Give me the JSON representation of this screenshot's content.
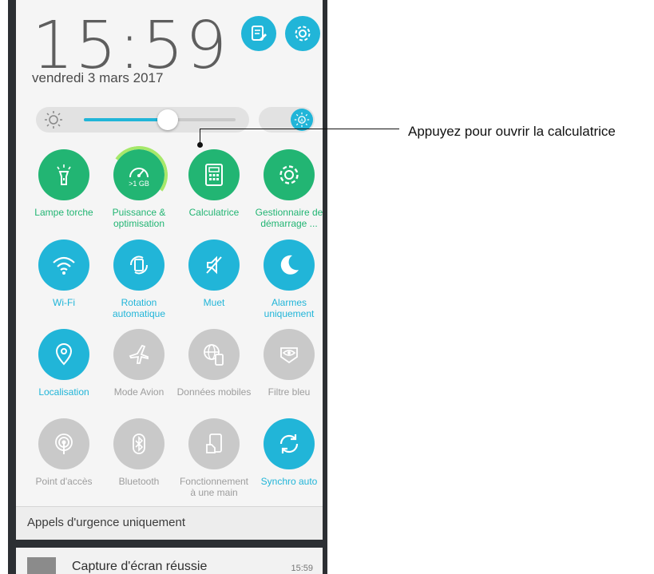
{
  "clock": {
    "time": "15:59",
    "date": "vendredi 3 mars 2017"
  },
  "header_buttons": [
    {
      "icon": "edit-icon"
    },
    {
      "icon": "gear-icon"
    }
  ],
  "brightness": {
    "level": 0.55,
    "auto_icon": "auto-brightness-icon"
  },
  "tiles": [
    {
      "label": "Lampe torche",
      "icon": "flashlight-icon",
      "state": "green"
    },
    {
      "label": "Puissance & optimisation",
      "icon": "speedometer-icon",
      "badge": ">1 GB",
      "state": "green"
    },
    {
      "label": "Calculatrice",
      "icon": "calculator-icon",
      "state": "green"
    },
    {
      "label": "Gestionnaire de démarrage ...",
      "icon": "gear-icon",
      "state": "green"
    },
    {
      "label": "Wi-Fi",
      "icon": "wifi-icon",
      "state": "blue"
    },
    {
      "label": "Rotation automatique",
      "icon": "rotation-icon",
      "state": "blue"
    },
    {
      "label": "Muet",
      "icon": "mute-icon",
      "state": "blue"
    },
    {
      "label": "Alarmes uniquement",
      "icon": "moon-icon",
      "state": "blue"
    },
    {
      "label": "Localisation",
      "icon": "location-icon",
      "state": "blue"
    },
    {
      "label": "Mode Avion",
      "icon": "airplane-icon",
      "state": "grey"
    },
    {
      "label": "Données mobiles",
      "icon": "mobile-data-icon",
      "state": "grey"
    },
    {
      "label": "Filtre bleu",
      "icon": "eye-icon",
      "state": "grey"
    },
    {
      "label": "Point d'accès",
      "icon": "hotspot-icon",
      "state": "grey"
    },
    {
      "label": "Bluetooth",
      "icon": "bluetooth-icon",
      "state": "grey"
    },
    {
      "label": "Fonctionnement à une main",
      "icon": "one-hand-icon",
      "state": "grey"
    },
    {
      "label": "Synchro auto",
      "icon": "sync-icon",
      "state": "blue"
    }
  ],
  "emergency": "Appels d'urgence uniquement",
  "notification": {
    "title": "Capture d'écran réussie",
    "time": "15:59"
  },
  "annotation": "Appuyez pour ouvrir la calculatrice"
}
